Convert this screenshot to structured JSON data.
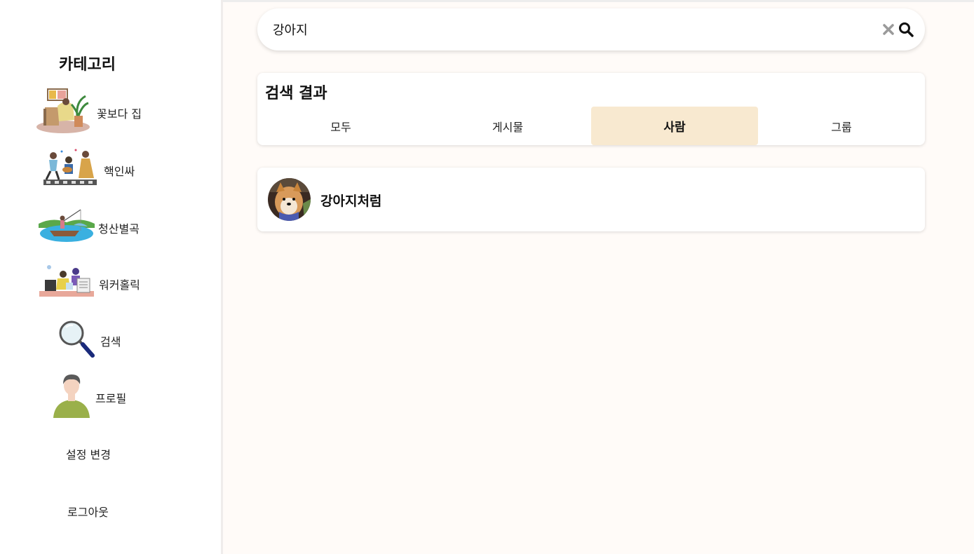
{
  "sidebar": {
    "title": "카테고리",
    "items": [
      {
        "label": "꽃보다 집"
      },
      {
        "label": "핵인싸"
      },
      {
        "label": "청산별곡"
      },
      {
        "label": "워커홀릭"
      },
      {
        "label": "검색"
      },
      {
        "label": "프로필"
      }
    ],
    "settings_label": "설정 변경",
    "logout_label": "로그아웃"
  },
  "search": {
    "value": "강아지",
    "placeholder": ""
  },
  "results": {
    "title": "검색 결과",
    "tabs": [
      {
        "label": "모두",
        "active": false
      },
      {
        "label": "게시물",
        "active": false
      },
      {
        "label": "사람",
        "active": true
      },
      {
        "label": "그룹",
        "active": false
      }
    ],
    "users": [
      {
        "name": "강아지처럼"
      }
    ]
  },
  "colors": {
    "page_bg": "#fffbf8",
    "active_tab_bg": "#f8e9d0"
  }
}
